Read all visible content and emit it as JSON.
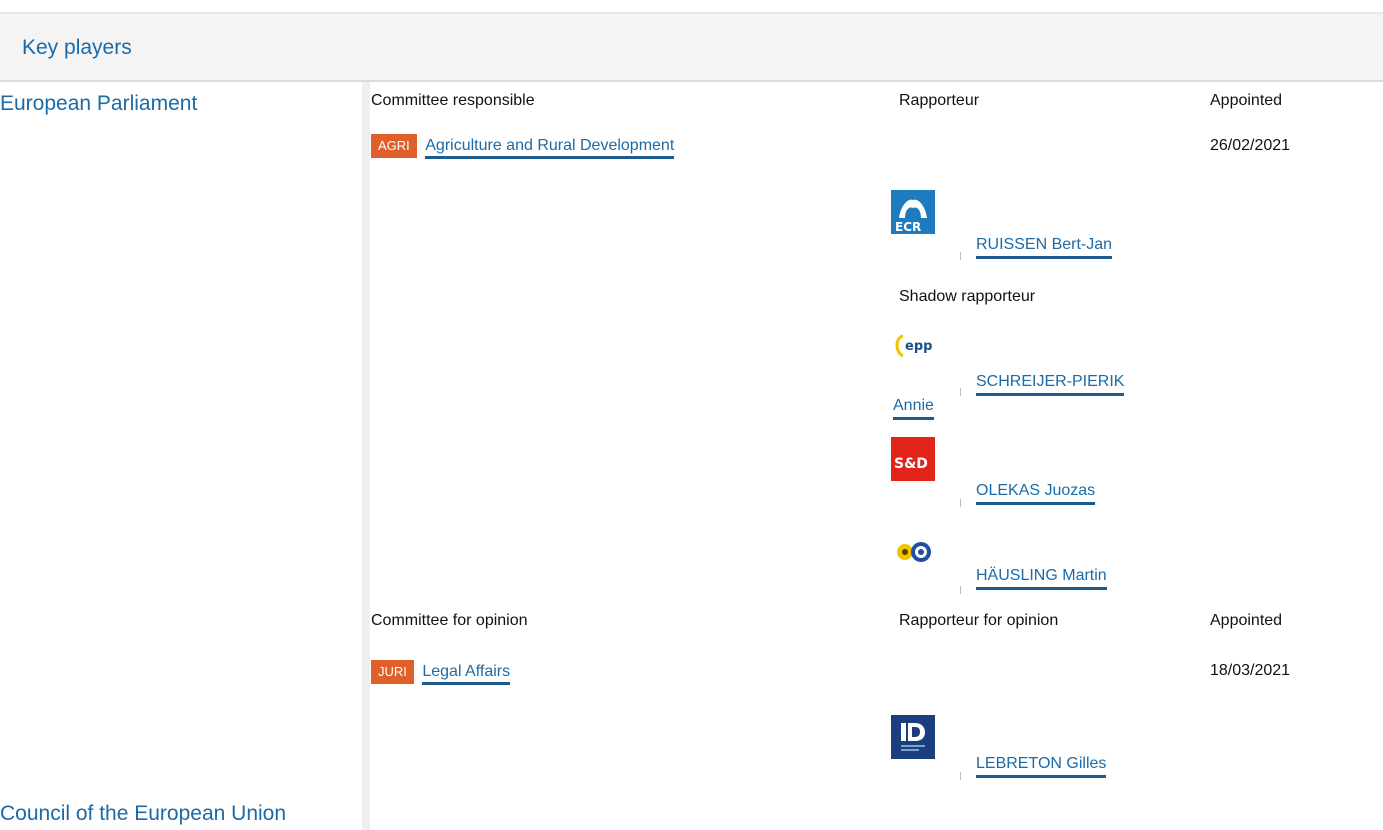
{
  "header": {
    "title": "Key players"
  },
  "sections": {
    "ep": "European Parliament",
    "council": "Council of the European Union"
  },
  "responsible": {
    "col_committee": "Committee responsible",
    "col_rapporteur": "Rapporteur",
    "col_appointed": "Appointed",
    "badge": "AGRI",
    "committee": "Agriculture and Rural Development",
    "date": "26/02/2021",
    "rapporteur": {
      "group_icon": "ecr-logo",
      "group_label": "ECR",
      "name": "RUISSEN Bert-Jan"
    },
    "shadow_label": "Shadow rapporteur",
    "shadows": [
      {
        "group_icon": "epp-logo",
        "group_label": "epp",
        "name_line1": "SCHREIJER-PIERIK",
        "name_line2": "Annie"
      },
      {
        "group_icon": "sd-logo",
        "group_label": "S&D",
        "name": "OLEKAS Juozas"
      },
      {
        "group_icon": "greens-efa-logo",
        "name": "HÄUSLING Martin"
      }
    ]
  },
  "opinion": {
    "col_committee": "Committee for opinion",
    "col_rapporteur": "Rapporteur for opinion",
    "col_appointed": "Appointed",
    "badge": "JURI",
    "committee": "Legal Affairs",
    "date": "18/03/2021",
    "rapporteur": {
      "group_icon": "id-logo",
      "name": "LEBRETON Gilles"
    }
  },
  "colors": {
    "link": "#1c6aa6",
    "badge": "#e0602b",
    "underline": "#1d5b8e"
  }
}
